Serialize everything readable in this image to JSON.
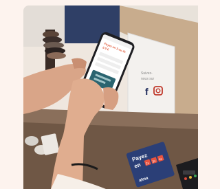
{
  "photo": {
    "description_free": true,
    "phone_screen": {
      "lines": [
        "Payez en 3 ou 4x",
        "à 0 €"
      ],
      "button_label": "..."
    },
    "stand_sign": {
      "text_lines": [
        "Suivez-",
        "nous sur"
      ]
    },
    "payment_sign": {
      "word_1": "Payez",
      "word_2": "en",
      "digits": [
        "2x",
        "3x",
        "4x"
      ],
      "brand": "alma"
    }
  }
}
